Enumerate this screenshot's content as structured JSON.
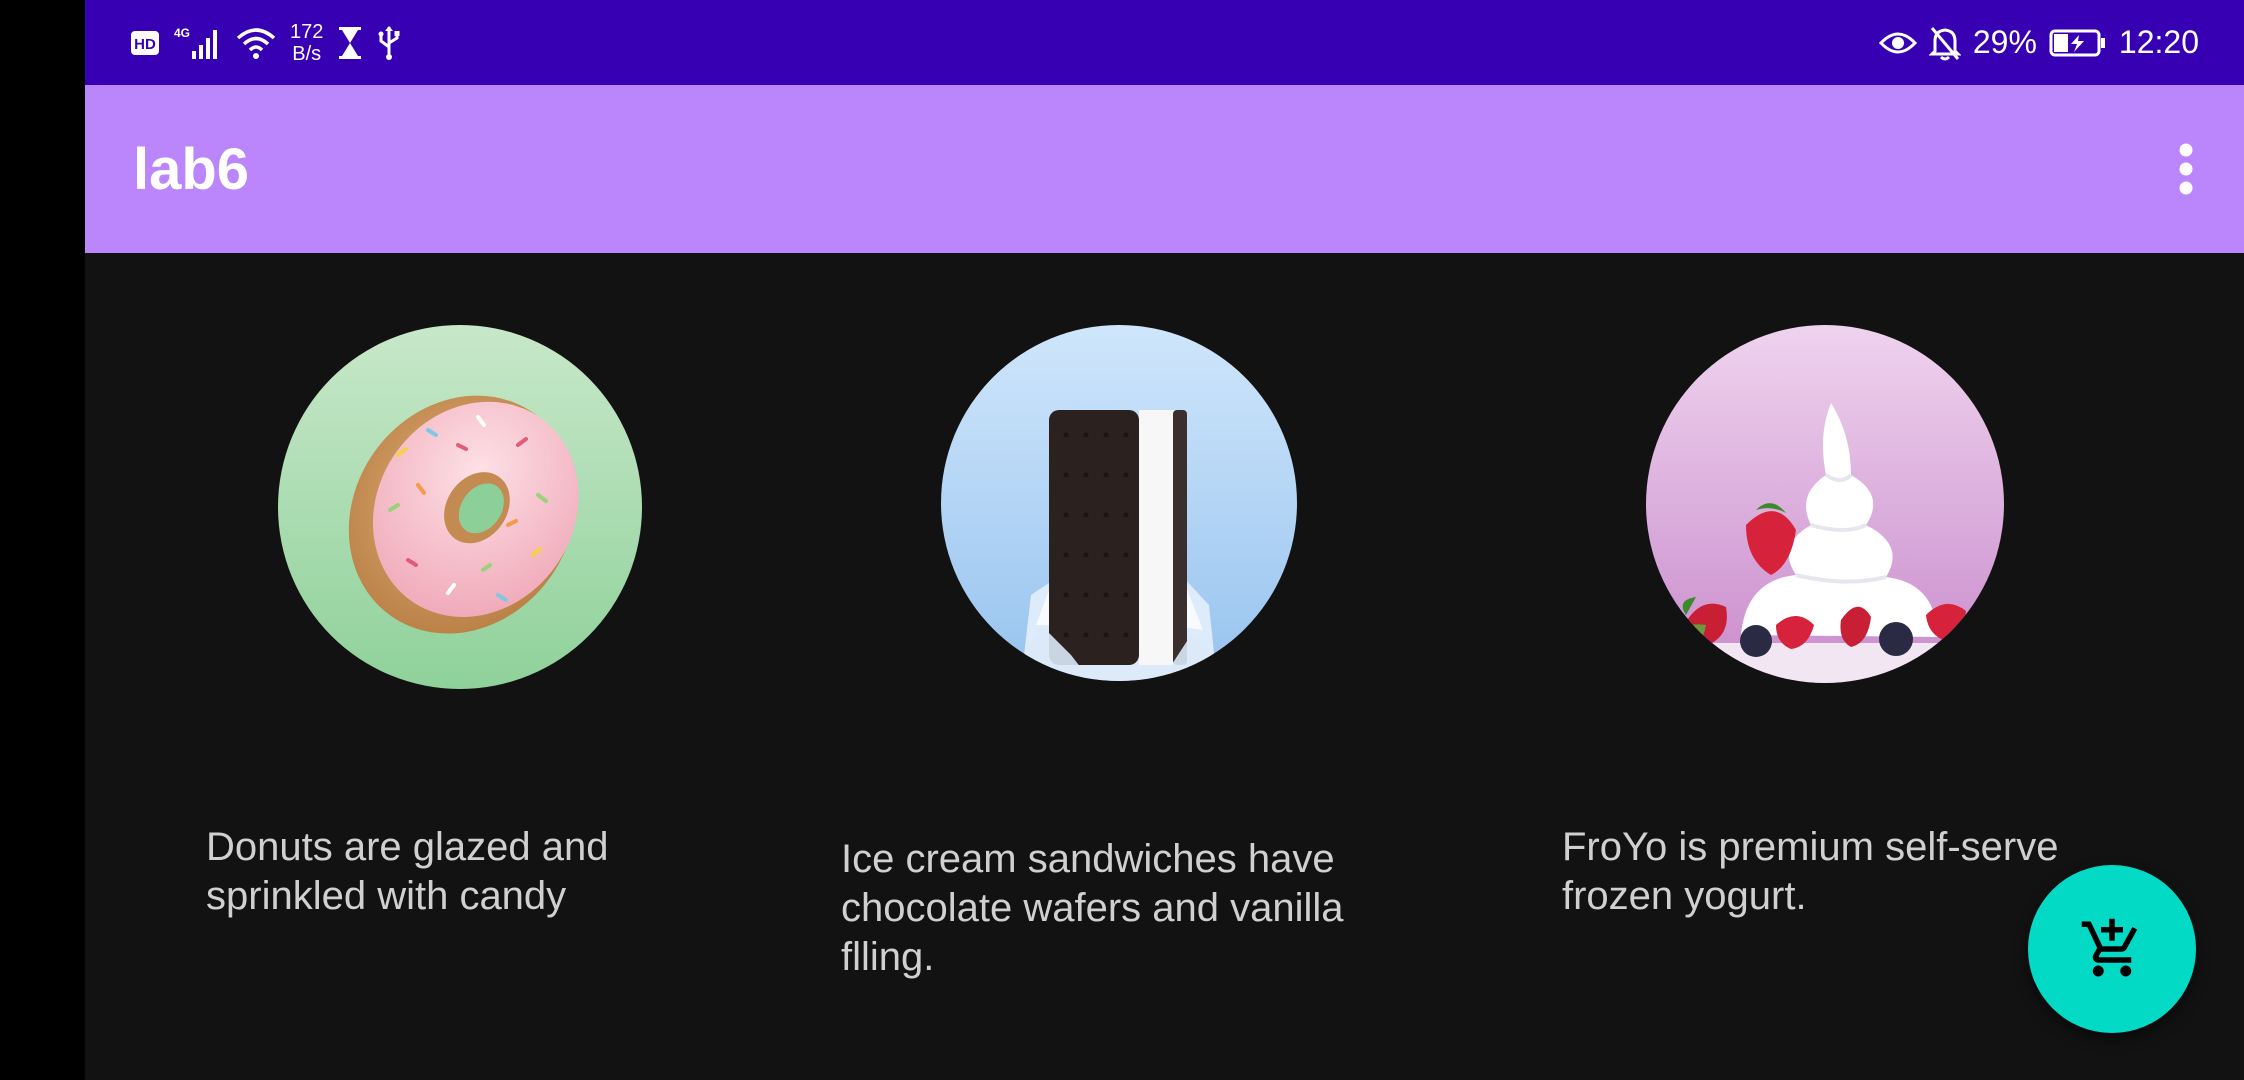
{
  "status_bar": {
    "network_type": "4G",
    "net_speed_value": "172",
    "net_speed_unit": "B/s",
    "battery_percent": "29%",
    "time": "12:20",
    "icons": [
      "hd-icon",
      "signal-icon",
      "wifi-icon",
      "hourglass-icon",
      "usb-icon",
      "eye-icon",
      "bell-off-icon",
      "battery-charging-icon"
    ],
    "background_color": "#3700b3"
  },
  "app_bar": {
    "title": "lab6",
    "background_color": "#bb86fc",
    "menu_icon": "more-vert-icon"
  },
  "desserts": [
    {
      "name": "donut",
      "image_icon": "donut-icon",
      "description": "Donuts are glazed and sprinkled with candy"
    },
    {
      "name": "ice-cream-sandwich",
      "image_icon": "ice-cream-sandwich-icon",
      "description": "Ice cream sandwiches have chocolate wafers and vanilla flling."
    },
    {
      "name": "froyo",
      "image_icon": "froyo-icon",
      "description": "FroYo is premium self-serve frozen yogurt."
    }
  ],
  "fab": {
    "icon": "add-shopping-cart-icon",
    "color": "#03dac5"
  },
  "colors": {
    "background": "#121212",
    "text": "#d0d0d0"
  }
}
